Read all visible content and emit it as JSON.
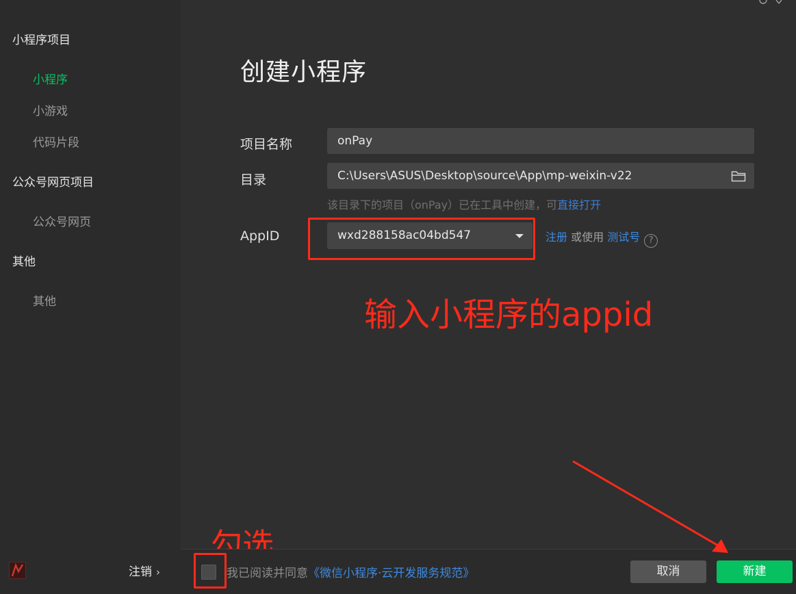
{
  "sidebar": {
    "group_miniprogram": "小程序项目",
    "item_miniprogram": "小程序",
    "item_minigame": "小游戏",
    "item_snippet": "代码片段",
    "group_official": "公众号网页项目",
    "item_official_web": "公众号网页",
    "group_other": "其他",
    "item_other": "其他",
    "logout_label": "注销",
    "logout_chevron": "›"
  },
  "main": {
    "title": "创建小程序",
    "project_name_label": "项目名称",
    "project_name_value": "onPay",
    "directory_label": "目录",
    "directory_value": "C:\\Users\\ASUS\\Desktop\\source\\App\\mp-weixin-v22",
    "hint_prefix": "该目录下的项目（onPay）已在工具中创建，可",
    "hint_link": "直接打开",
    "appid_label": "AppID",
    "appid_value": "wxd288158ac04bd547",
    "register_link": "注册",
    "or_use_text": "或使用",
    "test_account_link": "测试号",
    "help_glyph": "?"
  },
  "annotations": {
    "appid_note": "输入小程序的appid",
    "check_note": "勾选",
    "color": "#ff2a1a"
  },
  "footer": {
    "agree_text": "我已阅读并同意",
    "agree_link": "《微信小程序·云开发服务规范》",
    "cancel_label": "取消",
    "create_label": "新建"
  },
  "colors": {
    "accent": "#07c160",
    "link": "#3d8ae0"
  }
}
